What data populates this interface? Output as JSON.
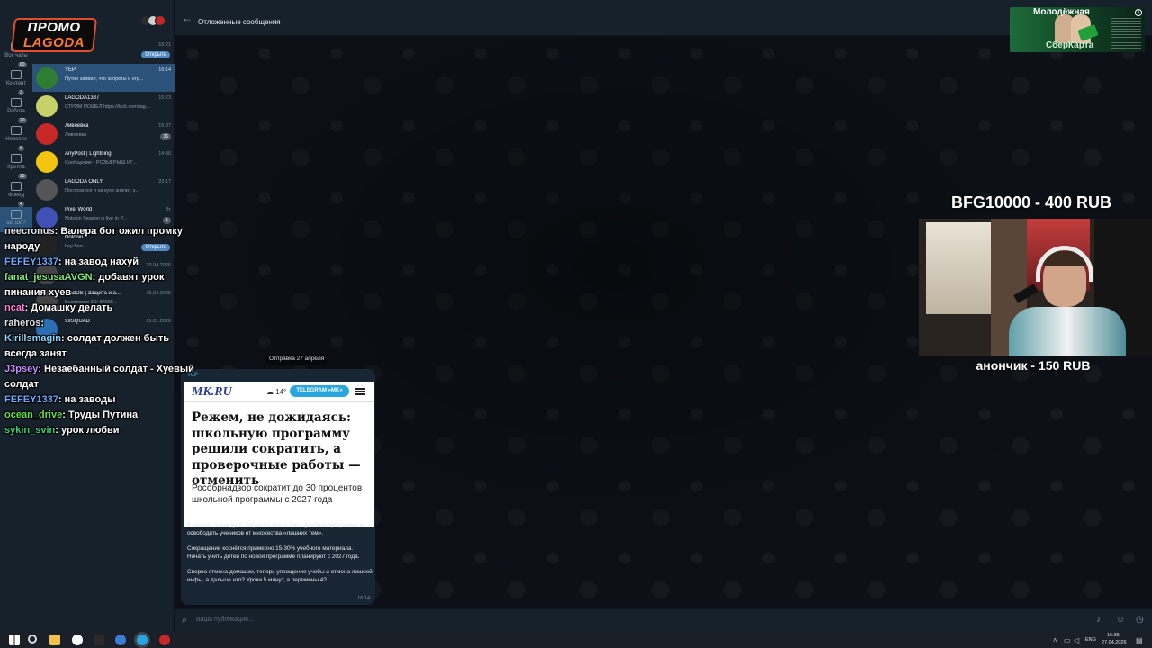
{
  "app": {
    "topbar_title": "Отложенные сообщения"
  },
  "promo": {
    "line1": "ПРОМО",
    "line2": "LAGODA"
  },
  "folders": [
    {
      "label": "Все чаты",
      "badge": ""
    },
    {
      "label": "Контент",
      "badge": "60"
    },
    {
      "label": "Работа",
      "badge": "3"
    },
    {
      "label": "Новости",
      "badge": "20"
    },
    {
      "label": "Крипта",
      "badge": "6"
    },
    {
      "label": "Френд",
      "badge": "13"
    },
    {
      "label": "шо шо?",
      "badge": "4"
    }
  ],
  "chats": [
    {
      "title": "YEP",
      "preview": "",
      "time": "16:21",
      "badge": "",
      "open": "Открыть",
      "color": "#3a4a5c"
    },
    {
      "title": "YEP",
      "preview": "Путин заявил, что запреты и огр...",
      "time": "16:14",
      "badge": "",
      "open": "",
      "color": "#2e7d32"
    },
    {
      "title": "LAGODA1337",
      "preview": "СТРИМ ПОШЕЛ https://kick.com/lag...",
      "time": "15:23",
      "badge": "",
      "open": "",
      "color": "#c7d16a"
    },
    {
      "title": "Ливневка",
      "preview": "Ливневка",
      "time": "15:07",
      "badge": "36",
      "open": "",
      "color": "#c62828"
    },
    {
      "title": "AnyPost | Lightning",
      "preview": "Сообщение • РОЗЫГРЫШ ИГ...",
      "time": "14:30",
      "badge": "",
      "open": "",
      "color": "#f1c40f"
    },
    {
      "title": "LAGODA ONLY",
      "preview": "Построился я на кухе значит, к...",
      "time": "23:17",
      "badge": "",
      "open": "",
      "color": "#555555"
    },
    {
      "title": "Pixel World",
      "preview": "Notcoin Season is live in P...",
      "time": "Вт",
      "badge": "1",
      "open": "",
      "color": "#3f51b5"
    },
    {
      "title": "Notcoin",
      "preview": "hey fren",
      "time": "",
      "badge": "",
      "open": "Открыть",
      "color": "#222222"
    },
    {
      "title": "LAGODA FILMS x B...",
      "preview": "",
      "time": "20.04.2026",
      "badge": "",
      "open": "",
      "color": "#444444"
    },
    {
      "title": "SladOS | Защита и а...",
      "preview": "Бесплатно 3D: 84655...",
      "time": "15.04.2026",
      "badge": "",
      "open": "",
      "color": "#444444"
    },
    {
      "title": "99SQUAD",
      "preview": "",
      "time": "01.01.2026",
      "badge": "",
      "open": "",
      "color": "#2c6fb5"
    }
  ],
  "stream_chat": [
    {
      "nick": "neecronus",
      "text": "Валера бот ожил промку народу",
      "color": "#dfe4ea"
    },
    {
      "nick": "FEFEY1337",
      "text": "на завод нахуй",
      "color": "#6fa8ff"
    },
    {
      "nick": "fanat_jesusaAVGN",
      "text": "добавят урок пинания хуев",
      "color": "#7ee87e"
    },
    {
      "nick": "ncat",
      "text": "Домашку делать",
      "color": "#ff7fd9"
    },
    {
      "nick": "raheros",
      "text": "",
      "color": "#dfe4ea"
    },
    {
      "nick": "Kirillsmagin",
      "text": "солдат должен быть всегда занят",
      "color": "#8ad7ff"
    },
    {
      "nick": "J3psey",
      "text": "Незаебанный солдат - Хуевый солдат",
      "color": "#c48bff"
    },
    {
      "nick": "FEFEY1337",
      "text": "на заводы",
      "color": "#6fa8ff"
    },
    {
      "nick": "ocean_drive",
      "text": "Труды Путина",
      "color": "#62e04a"
    },
    {
      "nick": "sykin_svin",
      "text": "урок любви",
      "color": "#33d17a"
    }
  ],
  "message": {
    "date_chip": "Отправка 27 апреля",
    "sender": "YEP",
    "shot": {
      "logo": "MK.RU",
      "weather": "14°",
      "tg_button": "TELEGRAM »MK«",
      "headline": "Режем, не дожидаясь: школьную программу решили сократить, а проверочные работы — отменить",
      "subhead": "Рособрнадзор сократит до 30 процентов школьной программы с 2027 года"
    },
    "paragraphs": [
      "В школах планируют сократить почти треть учебной программы и освободить учеников от множества «лишних тем».",
      "Сокращение коснётся примерно 15-30% учебного материала. Начать учить детей по новой программе планируют с 2027 года.",
      "Сперва отмена домашки, теперь упрощение учебы и отмена лишней инфы, а дальше что? Уроки 5 минут, а перемены 4?"
    ],
    "time": "16:14"
  },
  "input": {
    "placeholder": "Ваша публикация..."
  },
  "overlays": {
    "donation_top": "BFG10000 - 400 RUB",
    "donation_bottom": "анончик - 150 RUB",
    "sber_title": "Молодёжная",
    "sber_brand": "СберКарта"
  },
  "taskbar": {
    "lang": "ENG",
    "time": "16:35",
    "date": "27.04.2026"
  },
  "colors": {
    "accent": "#5288c1",
    "panel": "#17212b",
    "active": "#2b5278",
    "bubble": "#182533"
  }
}
